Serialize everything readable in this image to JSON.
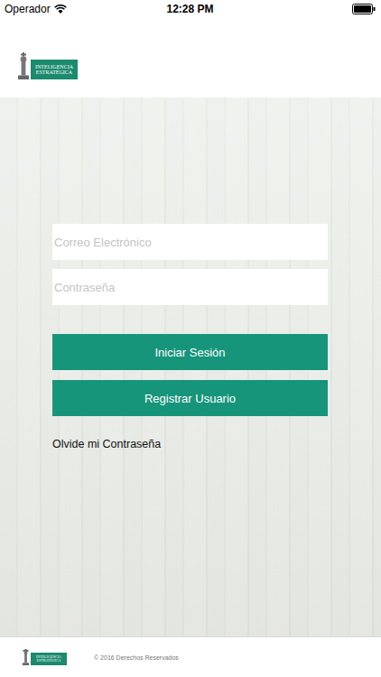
{
  "status_bar": {
    "carrier": "Operador",
    "time": "12:28 PM"
  },
  "logo": {
    "text": "INTELIGENCIA ESTRATÉGICA"
  },
  "form": {
    "email_placeholder": "Correo Electrónico",
    "password_placeholder": "Contraseña"
  },
  "buttons": [
    "Iniciar Sesión",
    "Registrar Usuario"
  ],
  "forgot_link": "Olvide mi Contraseña",
  "footer": {
    "copyright": "© 2016 Derechos Reservados"
  }
}
